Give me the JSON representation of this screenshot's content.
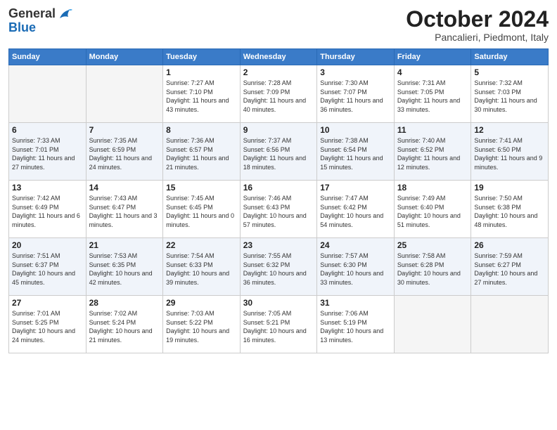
{
  "header": {
    "logo_general": "General",
    "logo_blue": "Blue",
    "month_title": "October 2024",
    "location": "Pancalieri, Piedmont, Italy"
  },
  "weekdays": [
    "Sunday",
    "Monday",
    "Tuesday",
    "Wednesday",
    "Thursday",
    "Friday",
    "Saturday"
  ],
  "days": [
    {
      "date": null,
      "info": null
    },
    {
      "date": null,
      "info": null
    },
    {
      "date": "1",
      "info": "Sunrise: 7:27 AM\nSunset: 7:10 PM\nDaylight: 11 hours and 43 minutes."
    },
    {
      "date": "2",
      "info": "Sunrise: 7:28 AM\nSunset: 7:09 PM\nDaylight: 11 hours and 40 minutes."
    },
    {
      "date": "3",
      "info": "Sunrise: 7:30 AM\nSunset: 7:07 PM\nDaylight: 11 hours and 36 minutes."
    },
    {
      "date": "4",
      "info": "Sunrise: 7:31 AM\nSunset: 7:05 PM\nDaylight: 11 hours and 33 minutes."
    },
    {
      "date": "5",
      "info": "Sunrise: 7:32 AM\nSunset: 7:03 PM\nDaylight: 11 hours and 30 minutes."
    },
    {
      "date": "6",
      "info": "Sunrise: 7:33 AM\nSunset: 7:01 PM\nDaylight: 11 hours and 27 minutes."
    },
    {
      "date": "7",
      "info": "Sunrise: 7:35 AM\nSunset: 6:59 PM\nDaylight: 11 hours and 24 minutes."
    },
    {
      "date": "8",
      "info": "Sunrise: 7:36 AM\nSunset: 6:57 PM\nDaylight: 11 hours and 21 minutes."
    },
    {
      "date": "9",
      "info": "Sunrise: 7:37 AM\nSunset: 6:56 PM\nDaylight: 11 hours and 18 minutes."
    },
    {
      "date": "10",
      "info": "Sunrise: 7:38 AM\nSunset: 6:54 PM\nDaylight: 11 hours and 15 minutes."
    },
    {
      "date": "11",
      "info": "Sunrise: 7:40 AM\nSunset: 6:52 PM\nDaylight: 11 hours and 12 minutes."
    },
    {
      "date": "12",
      "info": "Sunrise: 7:41 AM\nSunset: 6:50 PM\nDaylight: 11 hours and 9 minutes."
    },
    {
      "date": "13",
      "info": "Sunrise: 7:42 AM\nSunset: 6:49 PM\nDaylight: 11 hours and 6 minutes."
    },
    {
      "date": "14",
      "info": "Sunrise: 7:43 AM\nSunset: 6:47 PM\nDaylight: 11 hours and 3 minutes."
    },
    {
      "date": "15",
      "info": "Sunrise: 7:45 AM\nSunset: 6:45 PM\nDaylight: 11 hours and 0 minutes."
    },
    {
      "date": "16",
      "info": "Sunrise: 7:46 AM\nSunset: 6:43 PM\nDaylight: 10 hours and 57 minutes."
    },
    {
      "date": "17",
      "info": "Sunrise: 7:47 AM\nSunset: 6:42 PM\nDaylight: 10 hours and 54 minutes."
    },
    {
      "date": "18",
      "info": "Sunrise: 7:49 AM\nSunset: 6:40 PM\nDaylight: 10 hours and 51 minutes."
    },
    {
      "date": "19",
      "info": "Sunrise: 7:50 AM\nSunset: 6:38 PM\nDaylight: 10 hours and 48 minutes."
    },
    {
      "date": "20",
      "info": "Sunrise: 7:51 AM\nSunset: 6:37 PM\nDaylight: 10 hours and 45 minutes."
    },
    {
      "date": "21",
      "info": "Sunrise: 7:53 AM\nSunset: 6:35 PM\nDaylight: 10 hours and 42 minutes."
    },
    {
      "date": "22",
      "info": "Sunrise: 7:54 AM\nSunset: 6:33 PM\nDaylight: 10 hours and 39 minutes."
    },
    {
      "date": "23",
      "info": "Sunrise: 7:55 AM\nSunset: 6:32 PM\nDaylight: 10 hours and 36 minutes."
    },
    {
      "date": "24",
      "info": "Sunrise: 7:57 AM\nSunset: 6:30 PM\nDaylight: 10 hours and 33 minutes."
    },
    {
      "date": "25",
      "info": "Sunrise: 7:58 AM\nSunset: 6:28 PM\nDaylight: 10 hours and 30 minutes."
    },
    {
      "date": "26",
      "info": "Sunrise: 7:59 AM\nSunset: 6:27 PM\nDaylight: 10 hours and 27 minutes."
    },
    {
      "date": "27",
      "info": "Sunrise: 7:01 AM\nSunset: 5:25 PM\nDaylight: 10 hours and 24 minutes."
    },
    {
      "date": "28",
      "info": "Sunrise: 7:02 AM\nSunset: 5:24 PM\nDaylight: 10 hours and 21 minutes."
    },
    {
      "date": "29",
      "info": "Sunrise: 7:03 AM\nSunset: 5:22 PM\nDaylight: 10 hours and 19 minutes."
    },
    {
      "date": "30",
      "info": "Sunrise: 7:05 AM\nSunset: 5:21 PM\nDaylight: 10 hours and 16 minutes."
    },
    {
      "date": "31",
      "info": "Sunrise: 7:06 AM\nSunset: 5:19 PM\nDaylight: 10 hours and 13 minutes."
    },
    {
      "date": null,
      "info": null
    },
    {
      "date": null,
      "info": null
    }
  ]
}
